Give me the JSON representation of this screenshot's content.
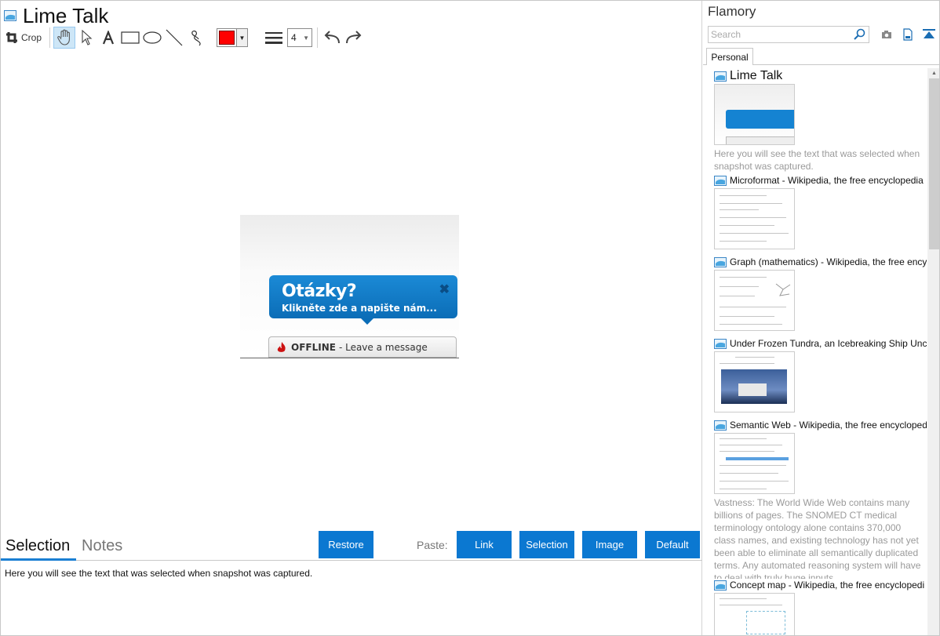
{
  "window": {
    "title": "Lime Talk"
  },
  "toolbar": {
    "crop_label": "Crop",
    "line_width": "4",
    "color": "#ff0000",
    "tools": [
      "hand-icon",
      "pointer-icon",
      "text-icon",
      "rectangle-icon",
      "ellipse-icon",
      "line-icon",
      "freehand-icon"
    ]
  },
  "snapshot": {
    "bubble_title": "Otázky?",
    "bubble_subtitle": "Klikněte zde a napište nám...",
    "offline_status": "OFFLINE",
    "offline_message": " - Leave a message"
  },
  "bottom": {
    "tabs": [
      "Selection",
      "Notes"
    ],
    "restore_label": "Restore",
    "paste_label": "Paste:",
    "paste_buttons": [
      "Link",
      "Selection",
      "Image",
      "Default"
    ],
    "selection_text": "Here you will see the text that was selected when snapshot was captured."
  },
  "sidebar": {
    "title": "Flamory",
    "search_placeholder": "Search",
    "tab": "Personal",
    "items": [
      {
        "title": "Lime Talk",
        "desc": "Here you will see the text that was selected when snapshot was captured."
      },
      {
        "title": "Microformat - Wikipedia, the free encyclopedia"
      },
      {
        "title": "Graph (mathematics) - Wikipedia, the free ency"
      },
      {
        "title": "Under Frozen Tundra, an Icebreaking Ship Unco"
      },
      {
        "title": "Semantic Web - Wikipedia, the free encycloped",
        "desc": "Vastness: The World Wide Web contains many billions of pages. The SNOMED CT medical terminology ontology alone contains 370,000 class names, and existing technology has not yet been able to eliminate all semantically duplicated terms. Any automated reasoning system will have to deal with truly huge inputs."
      },
      {
        "title": "Concept map - Wikipedia, the free encyclopedi"
      }
    ]
  },
  "colors": {
    "accent": "#0b78d1",
    "bubble": "#1b8ad6"
  }
}
